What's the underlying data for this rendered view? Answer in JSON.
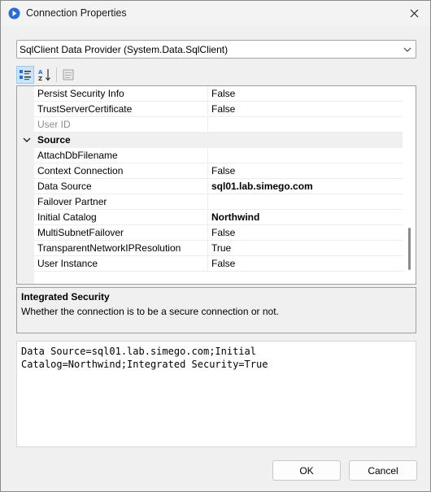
{
  "window": {
    "title": "Connection Properties"
  },
  "provider": {
    "selected": "SqlClient Data Provider (System.Data.SqlClient)"
  },
  "toolbar": {
    "categorized_icon": "categorized-icon",
    "alphabetical_icon": "alphabetical-icon",
    "property_pages_icon": "property-pages-icon"
  },
  "grid": {
    "rows_top": [
      {
        "name": "Persist Security Info",
        "value": "False",
        "bold": false,
        "readonly": false
      },
      {
        "name": "TrustServerCertificate",
        "value": "False",
        "bold": false,
        "readonly": false
      },
      {
        "name": "User ID",
        "value": "",
        "bold": false,
        "readonly": true
      }
    ],
    "category": "Source",
    "rows_source": [
      {
        "name": "AttachDbFilename",
        "value": "",
        "bold": false
      },
      {
        "name": "Context Connection",
        "value": "False",
        "bold": false
      },
      {
        "name": "Data Source",
        "value": "sql01.lab.simego.com",
        "bold": true
      },
      {
        "name": "Failover Partner",
        "value": "",
        "bold": false
      },
      {
        "name": "Initial Catalog",
        "value": "Northwind",
        "bold": true
      },
      {
        "name": "MultiSubnetFailover",
        "value": "False",
        "bold": false
      },
      {
        "name": "TransparentNetworkIPResolution",
        "value": "True",
        "bold": false
      },
      {
        "name": "User Instance",
        "value": "False",
        "bold": false
      }
    ]
  },
  "help": {
    "title": "Integrated Security",
    "description": "Whether the connection is to be a secure connection or not."
  },
  "connection_string": "Data Source=sql01.lab.simego.com;Initial Catalog=Northwind;Integrated Security=True",
  "buttons": {
    "ok": "OK",
    "cancel": "Cancel"
  },
  "colors": {
    "accent": "#2b6cd4",
    "selected_toolbar": "#cce4f7"
  }
}
